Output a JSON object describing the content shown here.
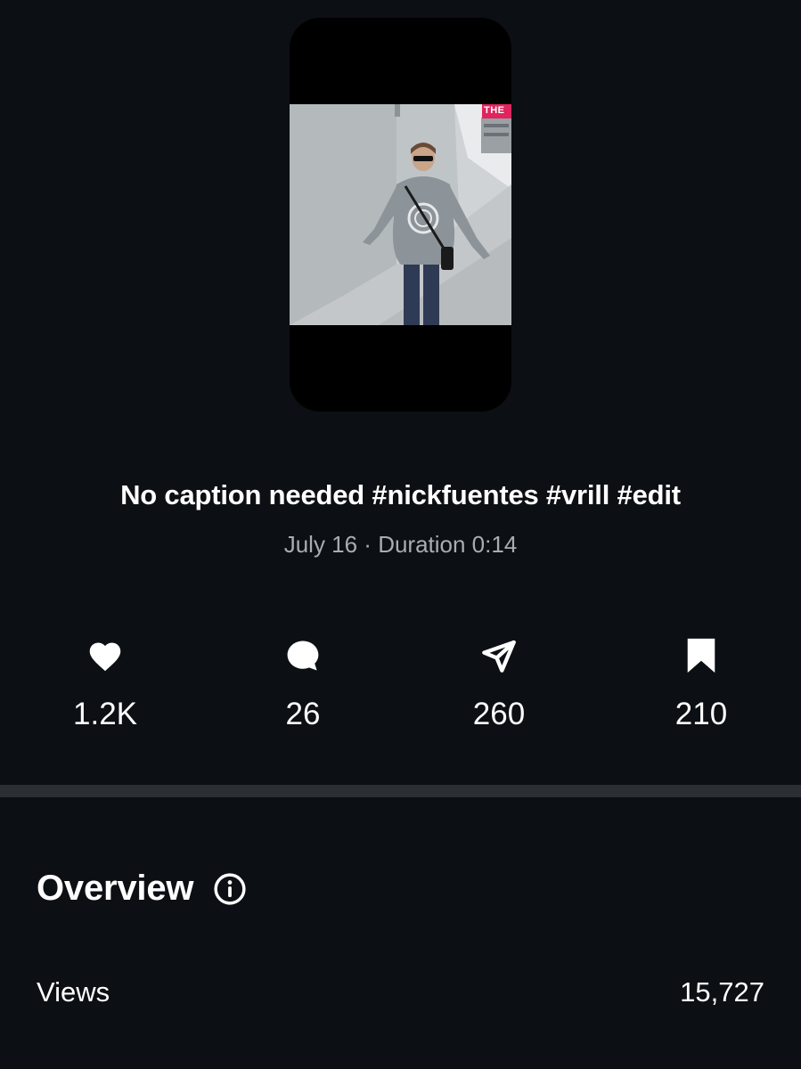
{
  "post": {
    "caption": "No caption needed #nickfuentes #vrill #edit",
    "meta": "July 16 · Duration 0:14",
    "thumbnail_overlay_text": "THE"
  },
  "stats": [
    {
      "icon": "heart-icon",
      "value": "1.2K"
    },
    {
      "icon": "comment-icon",
      "value": "26"
    },
    {
      "icon": "share-icon",
      "value": "260"
    },
    {
      "icon": "bookmark-icon",
      "value": "210"
    }
  ],
  "overview": {
    "title": "Overview",
    "rows": [
      {
        "label": "Views",
        "value": "15,727"
      }
    ]
  },
  "colors": {
    "background": "#0c0f13",
    "divider": "#2b2e33",
    "meta_text": "#a9adb3",
    "overlay_badge": "#e0245e"
  }
}
